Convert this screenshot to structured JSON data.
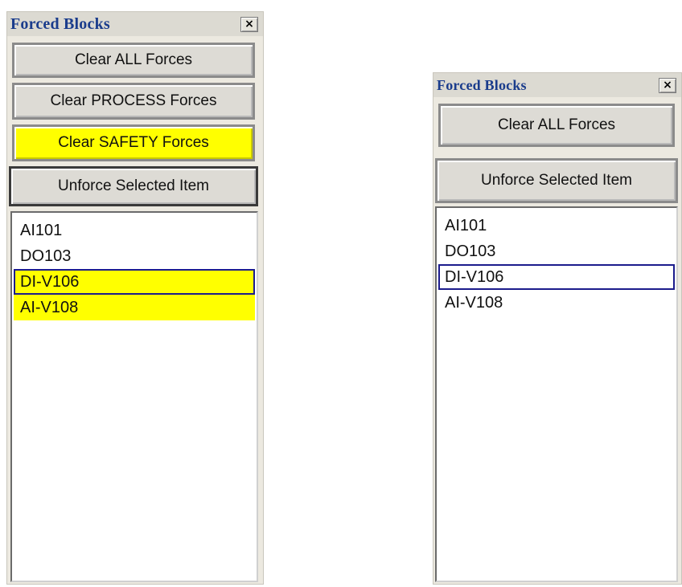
{
  "panels": [
    {
      "title": "Forced Blocks",
      "close_label": "×",
      "buttons": {
        "clear_all": "Clear ALL Forces",
        "clear_process": "Clear PROCESS Forces",
        "clear_safety": "Clear SAFETY Forces",
        "unforce": "Unforce Selected Item"
      },
      "items": [
        "AI101",
        "DO103",
        "DI-V106",
        "AI-V108"
      ],
      "highlight_color": "#FFFF00",
      "selected_item": "DI-V106"
    },
    {
      "title": "Forced Blocks",
      "close_label": "×",
      "buttons": {
        "clear_all": "Clear ALL Forces",
        "unforce": "Unforce Selected Item"
      },
      "items": [
        "AI101",
        "DO103",
        "DI-V106",
        "AI-V108"
      ],
      "selected_item": "DI-V106"
    }
  ]
}
